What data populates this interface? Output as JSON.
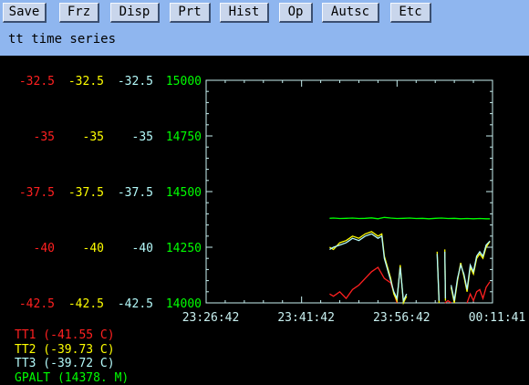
{
  "toolbar": {
    "buttons": [
      {
        "label": "Save"
      },
      {
        "label": "Frz"
      },
      {
        "label": "Disp"
      },
      {
        "label": "Prt"
      },
      {
        "label": "Hist"
      },
      {
        "label": "Op"
      },
      {
        "label": "Autsc"
      },
      {
        "label": "Etc"
      }
    ]
  },
  "window": {
    "title": "tt time series"
  },
  "colors": {
    "tt1": "#ff2020",
    "tt2": "#ffff00",
    "tt3": "#b4fafa",
    "gpalt": "#00ff00",
    "axis": "#c8f0f0",
    "toolbar_bg": "#8fb6ef"
  },
  "chart_data": {
    "type": "line",
    "x_ticks": [
      "23:26:42",
      "23:41:42",
      "23:56:42",
      "00:11:41"
    ],
    "y_left_ticks": {
      "TT1": [
        "-32.5",
        "-35",
        "-37.5",
        "-40",
        "-42.5"
      ],
      "TT2": [
        "-32.5",
        "-35",
        "-37.5",
        "-40",
        "-42.5"
      ],
      "TT3": [
        "-32.5",
        "-35",
        "-37.5",
        "-40",
        "-42.5"
      ],
      "GPALT": [
        "15000",
        "14750",
        "14500",
        "14250",
        "14000"
      ]
    },
    "temp_range": [
      -42.5,
      -32.5
    ],
    "alt_range": [
      14000,
      15000
    ],
    "x_range_min": [
      0,
      45
    ],
    "series": [
      {
        "name": "GPALT",
        "unit": "M",
        "axis": "alt",
        "points": [
          [
            19.4,
            14380
          ],
          [
            20,
            14381
          ],
          [
            21,
            14379
          ],
          [
            22,
            14380
          ],
          [
            23,
            14381
          ],
          [
            24,
            14379
          ],
          [
            25,
            14380
          ],
          [
            26,
            14382
          ],
          [
            27,
            14378
          ],
          [
            28,
            14384
          ],
          [
            29,
            14381
          ],
          [
            30,
            14379
          ],
          [
            31,
            14380
          ],
          [
            32,
            14381
          ],
          [
            33,
            14379
          ],
          [
            34,
            14380
          ],
          [
            35,
            14378
          ],
          [
            36,
            14380
          ],
          [
            37,
            14381
          ],
          [
            38,
            14379
          ],
          [
            39,
            14380
          ],
          [
            40,
            14378
          ],
          [
            41,
            14379
          ],
          [
            42,
            14378
          ],
          [
            43,
            14379
          ],
          [
            44,
            14378
          ],
          [
            44.6,
            14378
          ]
        ]
      },
      {
        "name": "TT1",
        "unit": "C",
        "axis": "temp",
        "points": [
          [
            19.4,
            -42.1
          ],
          [
            20,
            -42.2
          ],
          [
            21,
            -42.0
          ],
          [
            22,
            -42.3
          ],
          [
            23,
            -41.9
          ],
          [
            24,
            -41.7
          ],
          [
            25,
            -41.4
          ],
          [
            26,
            -41.1
          ],
          [
            27,
            -40.9
          ],
          [
            28,
            -41.4
          ],
          [
            29,
            -41.6
          ],
          [
            30,
            -42.5
          ],
          [
            null,
            null
          ],
          [
            37.5,
            -42.5
          ],
          [
            38,
            -42.4
          ],
          [
            38.5,
            -42.5
          ],
          [
            null,
            null
          ],
          [
            41,
            -42.5
          ],
          [
            41.5,
            -42.1
          ],
          [
            42,
            -42.4
          ],
          [
            42.5,
            -42.0
          ],
          [
            43,
            -41.9
          ],
          [
            43.5,
            -42.3
          ],
          [
            44,
            -41.8
          ],
          [
            44.6,
            -41.55
          ]
        ]
      },
      {
        "name": "TT2",
        "unit": "C",
        "axis": "temp",
        "points": [
          [
            19.4,
            -40.0
          ],
          [
            20,
            -40.1
          ],
          [
            21,
            -39.8
          ],
          [
            22,
            -39.7
          ],
          [
            23,
            -39.5
          ],
          [
            24,
            -39.6
          ],
          [
            25,
            -39.4
          ],
          [
            26,
            -39.3
          ],
          [
            27,
            -39.5
          ],
          [
            27.6,
            -39.4
          ],
          [
            28,
            -40.4
          ],
          [
            29,
            -41.4
          ],
          [
            29.5,
            -42.1
          ],
          [
            30,
            -42.4
          ],
          [
            30.5,
            -40.8
          ],
          [
            31,
            -42.5
          ],
          [
            31.5,
            -42.2
          ],
          [
            null,
            null
          ],
          [
            36.3,
            -40.2
          ],
          [
            36.6,
            -42.5
          ],
          [
            null,
            null
          ],
          [
            37.5,
            -40.1
          ],
          [
            37.6,
            -42.4
          ],
          [
            null,
            null
          ],
          [
            38.5,
            -41.8
          ],
          [
            39,
            -42.5
          ],
          [
            39.5,
            -41.5
          ],
          [
            40,
            -40.7
          ],
          [
            40.5,
            -41.3
          ],
          [
            41,
            -42.0
          ],
          [
            41.5,
            -40.9
          ],
          [
            42,
            -41.2
          ],
          [
            42.5,
            -40.5
          ],
          [
            43,
            -40.3
          ],
          [
            43.5,
            -40.5
          ],
          [
            44,
            -40.0
          ],
          [
            44.6,
            -39.73
          ]
        ]
      },
      {
        "name": "TT3",
        "unit": "C",
        "axis": "temp",
        "points": [
          [
            19.4,
            -40.1
          ],
          [
            20,
            -40.0
          ],
          [
            21,
            -39.9
          ],
          [
            22,
            -39.8
          ],
          [
            23,
            -39.6
          ],
          [
            24,
            -39.7
          ],
          [
            25,
            -39.5
          ],
          [
            26,
            -39.4
          ],
          [
            27,
            -39.6
          ],
          [
            27.6,
            -39.5
          ],
          [
            28,
            -40.5
          ],
          [
            29,
            -41.5
          ],
          [
            29.5,
            -42.0
          ],
          [
            30,
            -42.3
          ],
          [
            30.5,
            -40.9
          ],
          [
            31,
            -42.4
          ],
          [
            31.5,
            -42.1
          ],
          [
            null,
            null
          ],
          [
            36.3,
            -40.3
          ],
          [
            36.6,
            -42.4
          ],
          [
            null,
            null
          ],
          [
            37.5,
            -40.2
          ],
          [
            37.6,
            -42.3
          ],
          [
            null,
            null
          ],
          [
            38.5,
            -41.7
          ],
          [
            39,
            -42.4
          ],
          [
            39.5,
            -41.4
          ],
          [
            40,
            -40.8
          ],
          [
            40.5,
            -41.2
          ],
          [
            41,
            -41.9
          ],
          [
            41.5,
            -40.8
          ],
          [
            42,
            -41.1
          ],
          [
            42.5,
            -40.4
          ],
          [
            43,
            -40.2
          ],
          [
            43.5,
            -40.4
          ],
          [
            44,
            -39.9
          ],
          [
            44.6,
            -39.72
          ]
        ]
      }
    ]
  },
  "legend": [
    {
      "text": "TT1 (-41.55 C)",
      "key": "tt1"
    },
    {
      "text": "TT2 (-39.73 C)",
      "key": "tt2"
    },
    {
      "text": "TT3 (-39.72 C)",
      "key": "tt3"
    },
    {
      "text": "GPALT (14378. M)",
      "key": "gpalt"
    }
  ]
}
